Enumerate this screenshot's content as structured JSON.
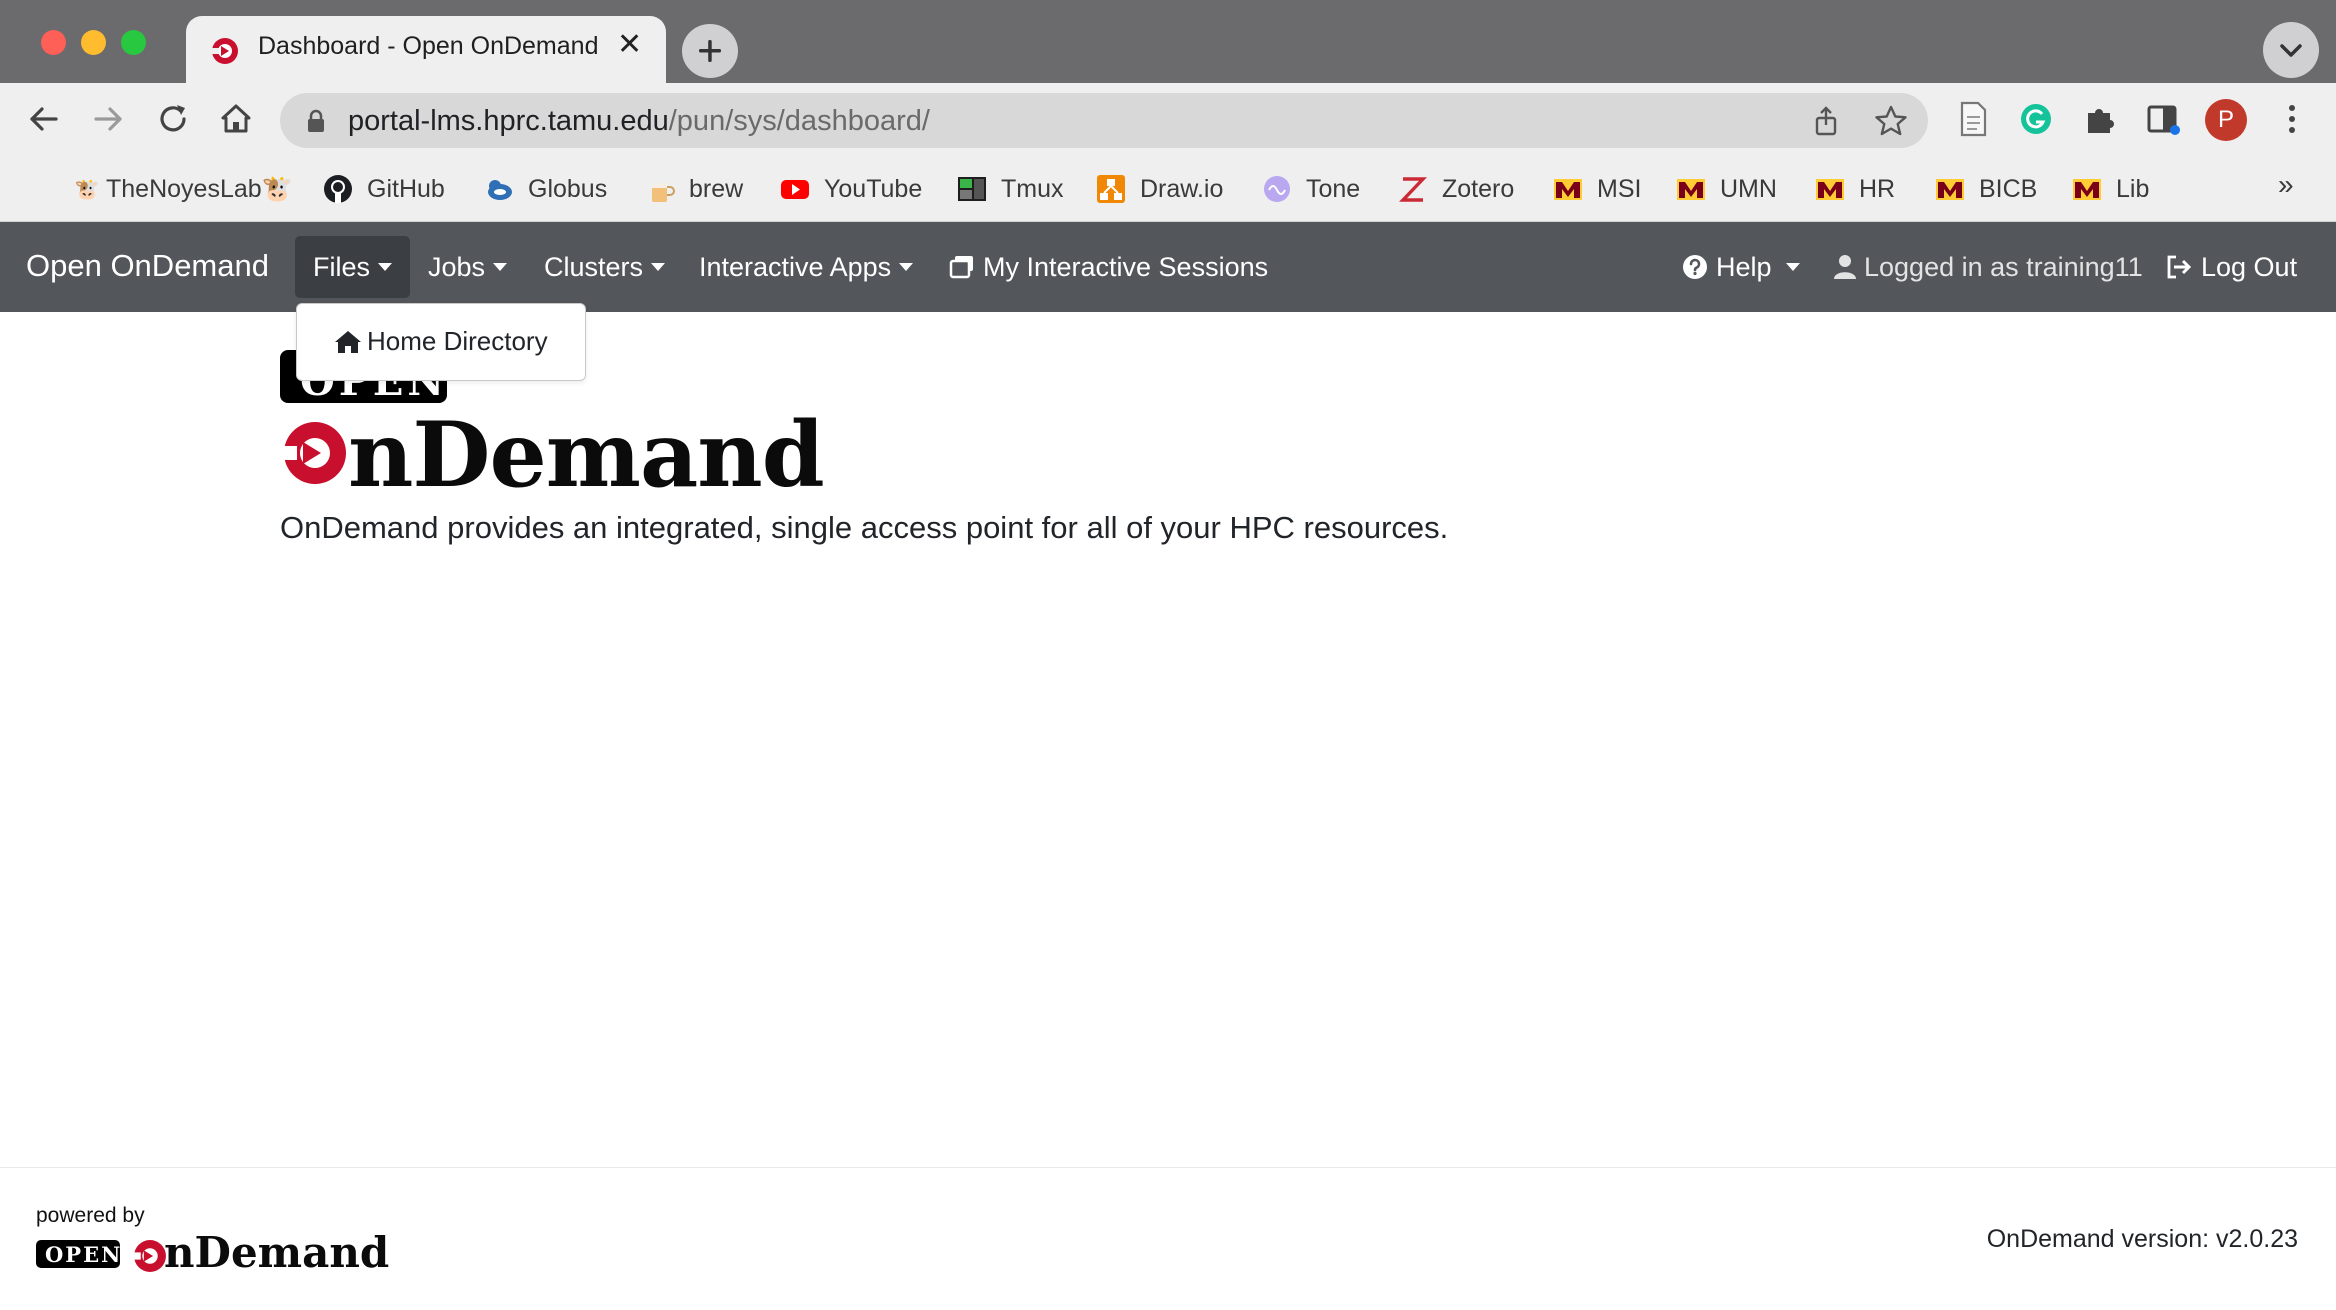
{
  "browser": {
    "tab": {
      "title": "Dashboard - Open OnDemand",
      "favicon": "ondemand-logo-icon"
    },
    "url": {
      "host": "portal-lms.hprc.tamu.edu",
      "path": "/pun/sys/dashboard/"
    },
    "profile_initial": "P",
    "bookmarks": [
      {
        "label": "TheNoyesLab🐮",
        "icon": "cow-emoji-icon"
      },
      {
        "label": "GitHub",
        "icon": "github-icon"
      },
      {
        "label": "Globus",
        "icon": "globus-icon"
      },
      {
        "label": "brew",
        "icon": "brew-icon"
      },
      {
        "label": "YouTube",
        "icon": "youtube-icon"
      },
      {
        "label": "Tmux",
        "icon": "tmux-icon"
      },
      {
        "label": "Draw.io",
        "icon": "drawio-icon"
      },
      {
        "label": "Tone",
        "icon": "tone-icon"
      },
      {
        "label": "Zotero",
        "icon": "zotero-icon"
      },
      {
        "label": "MSI",
        "icon": "umn-m-icon"
      },
      {
        "label": "UMN",
        "icon": "umn-m-icon"
      },
      {
        "label": "HR",
        "icon": "umn-m-icon"
      },
      {
        "label": "BICB",
        "icon": "umn-m-icon"
      },
      {
        "label": "Lib",
        "icon": "umn-m-icon"
      }
    ],
    "bookmarks_overflow": "»"
  },
  "navbar": {
    "brand": "Open OnDemand",
    "files": "Files",
    "jobs": "Jobs",
    "clusters": "Clusters",
    "interactive_apps": "Interactive Apps",
    "my_sessions": "My Interactive Sessions",
    "help": "Help",
    "logged_in": "Logged in as training11",
    "logout": "Log Out"
  },
  "files_dropdown": {
    "home_directory": "Home Directory"
  },
  "main": {
    "logo_open": "OPEN",
    "logo_wordmark": "nDemand",
    "tagline": "OnDemand provides an integrated, single access point for all of your HPC resources."
  },
  "footer": {
    "powered_by": "powered by",
    "logo_open": "OPEN",
    "logo_wordmark": "nDemand",
    "version": "OnDemand version: v2.0.23"
  },
  "colors": {
    "navbar_bg": "#53565a",
    "ondemand_red": "#c8102e",
    "umn_maroon": "#7a0019",
    "umn_gold": "#ffcc33"
  }
}
